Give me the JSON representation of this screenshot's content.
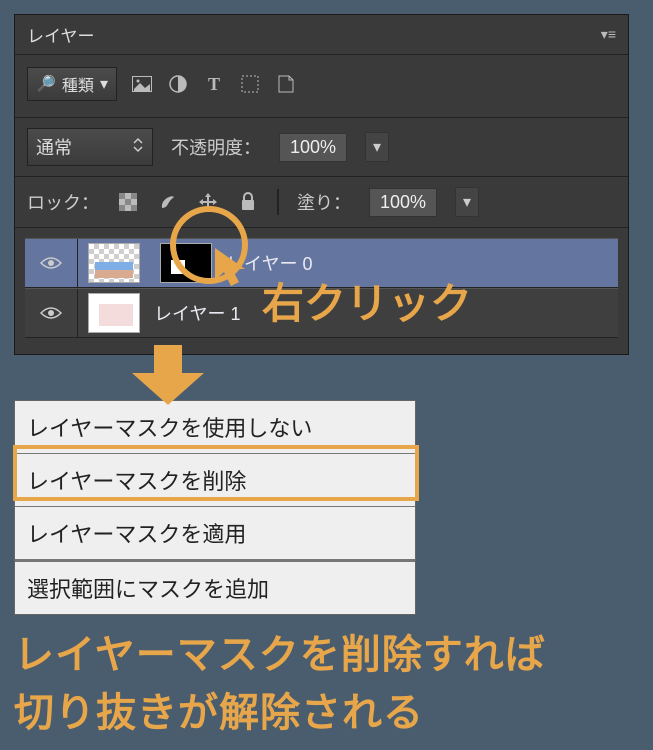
{
  "panel": {
    "title": "レイヤー",
    "filter_label": "種類",
    "blend_mode": "通常",
    "opacity_label": "不透明度：",
    "opacity_value": "100%",
    "lock_label": "ロック：",
    "fill_label": "塗り：",
    "fill_value": "100%"
  },
  "layers": [
    {
      "name": "レイヤー 0",
      "selected": true,
      "has_mask": true
    },
    {
      "name": "レイヤー 1",
      "selected": false,
      "has_mask": false
    }
  ],
  "context_menu": {
    "items": [
      "レイヤーマスクを使用しない",
      "レイヤーマスクを削除",
      "レイヤーマスクを適用",
      "選択範囲にマスクを追加"
    ],
    "highlighted_index": 1
  },
  "annotations": {
    "right_click": "右クリック",
    "bottom_line1": "レイヤーマスクを削除すれば",
    "bottom_line2": "切り抜きが解除される"
  }
}
